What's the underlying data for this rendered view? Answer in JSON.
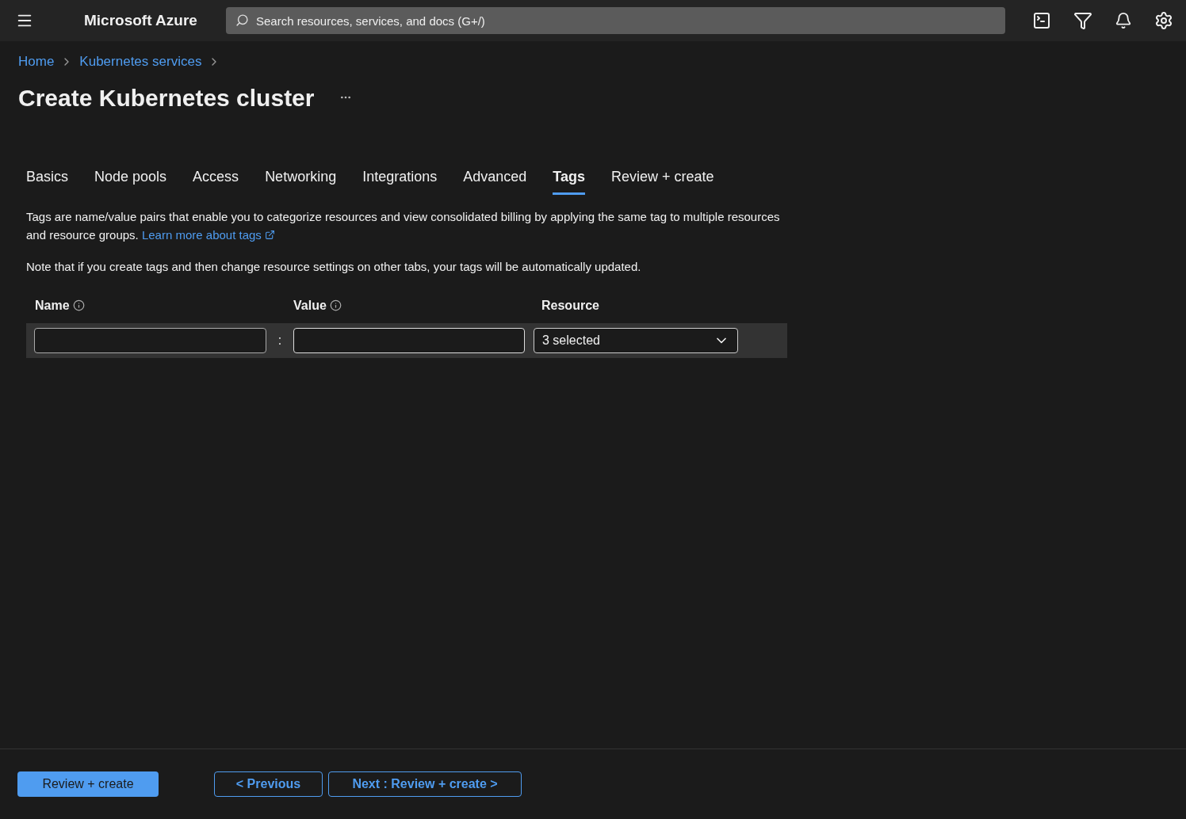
{
  "topbar": {
    "brand": "Microsoft Azure",
    "search": {
      "placeholder": "Search resources, services, and docs (G+/)"
    }
  },
  "breadcrumb": [
    "Home",
    "Kubernetes services"
  ],
  "page": {
    "title": "Create Kubernetes cluster"
  },
  "tabs": [
    {
      "label": "Basics",
      "selected": false
    },
    {
      "label": "Node pools",
      "selected": false
    },
    {
      "label": "Access",
      "selected": false
    },
    {
      "label": "Networking",
      "selected": false
    },
    {
      "label": "Integrations",
      "selected": false
    },
    {
      "label": "Advanced",
      "selected": false
    },
    {
      "label": "Tags",
      "selected": true
    },
    {
      "label": "Review + create",
      "selected": false
    }
  ],
  "intro": {
    "text": "Tags are name/value pairs that enable you to categorize resources and view consolidated billing by applying the same tag to multiple resources and resource groups.",
    "link": "Learn more about tags"
  },
  "note": "Note that if you create tags and then change resource settings on other tabs, your tags will be automatically updated.",
  "tags_table": {
    "columns": [
      "Name",
      "Value",
      "Resource"
    ],
    "separator": ":",
    "rows": [
      {
        "name": "",
        "value": "",
        "resource": "3 selected"
      }
    ]
  },
  "footer": {
    "primary": "Review + create",
    "previous": "< Previous",
    "next": "Next : Review + create >"
  }
}
